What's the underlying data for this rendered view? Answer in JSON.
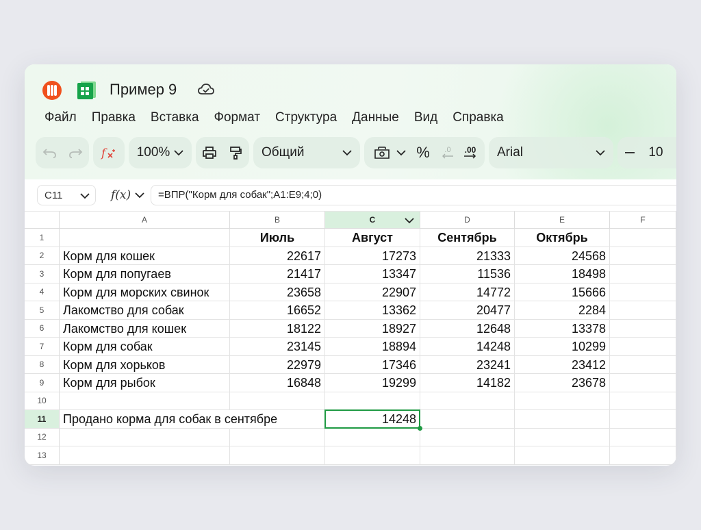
{
  "app": {
    "doc_title": "Пример 9"
  },
  "menu": [
    "Файл",
    "Правка",
    "Вставка",
    "Формат",
    "Структура",
    "Данные",
    "Вид",
    "Справка"
  ],
  "toolbar": {
    "zoom": "100%",
    "number_format": "Общий",
    "font": "Arial",
    "font_size": "10",
    "decrease_decimals": ".0",
    "increase_decimals": ".00",
    "percent": "%"
  },
  "formula_bar": {
    "cell_ref": "C11",
    "fx_label": "f(x)",
    "formula": "=ВПР(\"Корм для собак\";A1:E9;4;0)"
  },
  "columns": [
    "A",
    "B",
    "C",
    "D",
    "E",
    "F"
  ],
  "active_column": "C",
  "rows": [
    "1",
    "2",
    "3",
    "4",
    "5",
    "6",
    "7",
    "8",
    "9",
    "10",
    "11",
    "12",
    "13"
  ],
  "active_row": "11",
  "table": {
    "headers": [
      "",
      "Июль",
      "Август",
      "Сентябрь",
      "Октябрь"
    ],
    "data": [
      [
        "Корм для кошек",
        "22617",
        "17273",
        "21333",
        "24568"
      ],
      [
        "Корм для попугаев",
        "21417",
        "13347",
        "11536",
        "18498"
      ],
      [
        "Корм для морских свинок",
        "23658",
        "22907",
        "14772",
        "15666"
      ],
      [
        "Лакомство для собак",
        "16652",
        "13362",
        "20477",
        "2284"
      ],
      [
        "Лакомство для кошек",
        "18122",
        "18927",
        "12648",
        "13378"
      ],
      [
        "Корм для собак",
        "23145",
        "18894",
        "14248",
        "10299"
      ],
      [
        "Корм для хорьков",
        "22979",
        "17346",
        "23241",
        "23412"
      ],
      [
        "Корм для рыбок",
        "16848",
        "19299",
        "14182",
        "23678"
      ]
    ]
  },
  "summary": {
    "label": "Продано корма для собак в сентябре",
    "value": "14248"
  },
  "colors": {
    "accent": "#1f9a43",
    "header_active": "#d9f0de",
    "brand_orange": "#f0511e"
  }
}
